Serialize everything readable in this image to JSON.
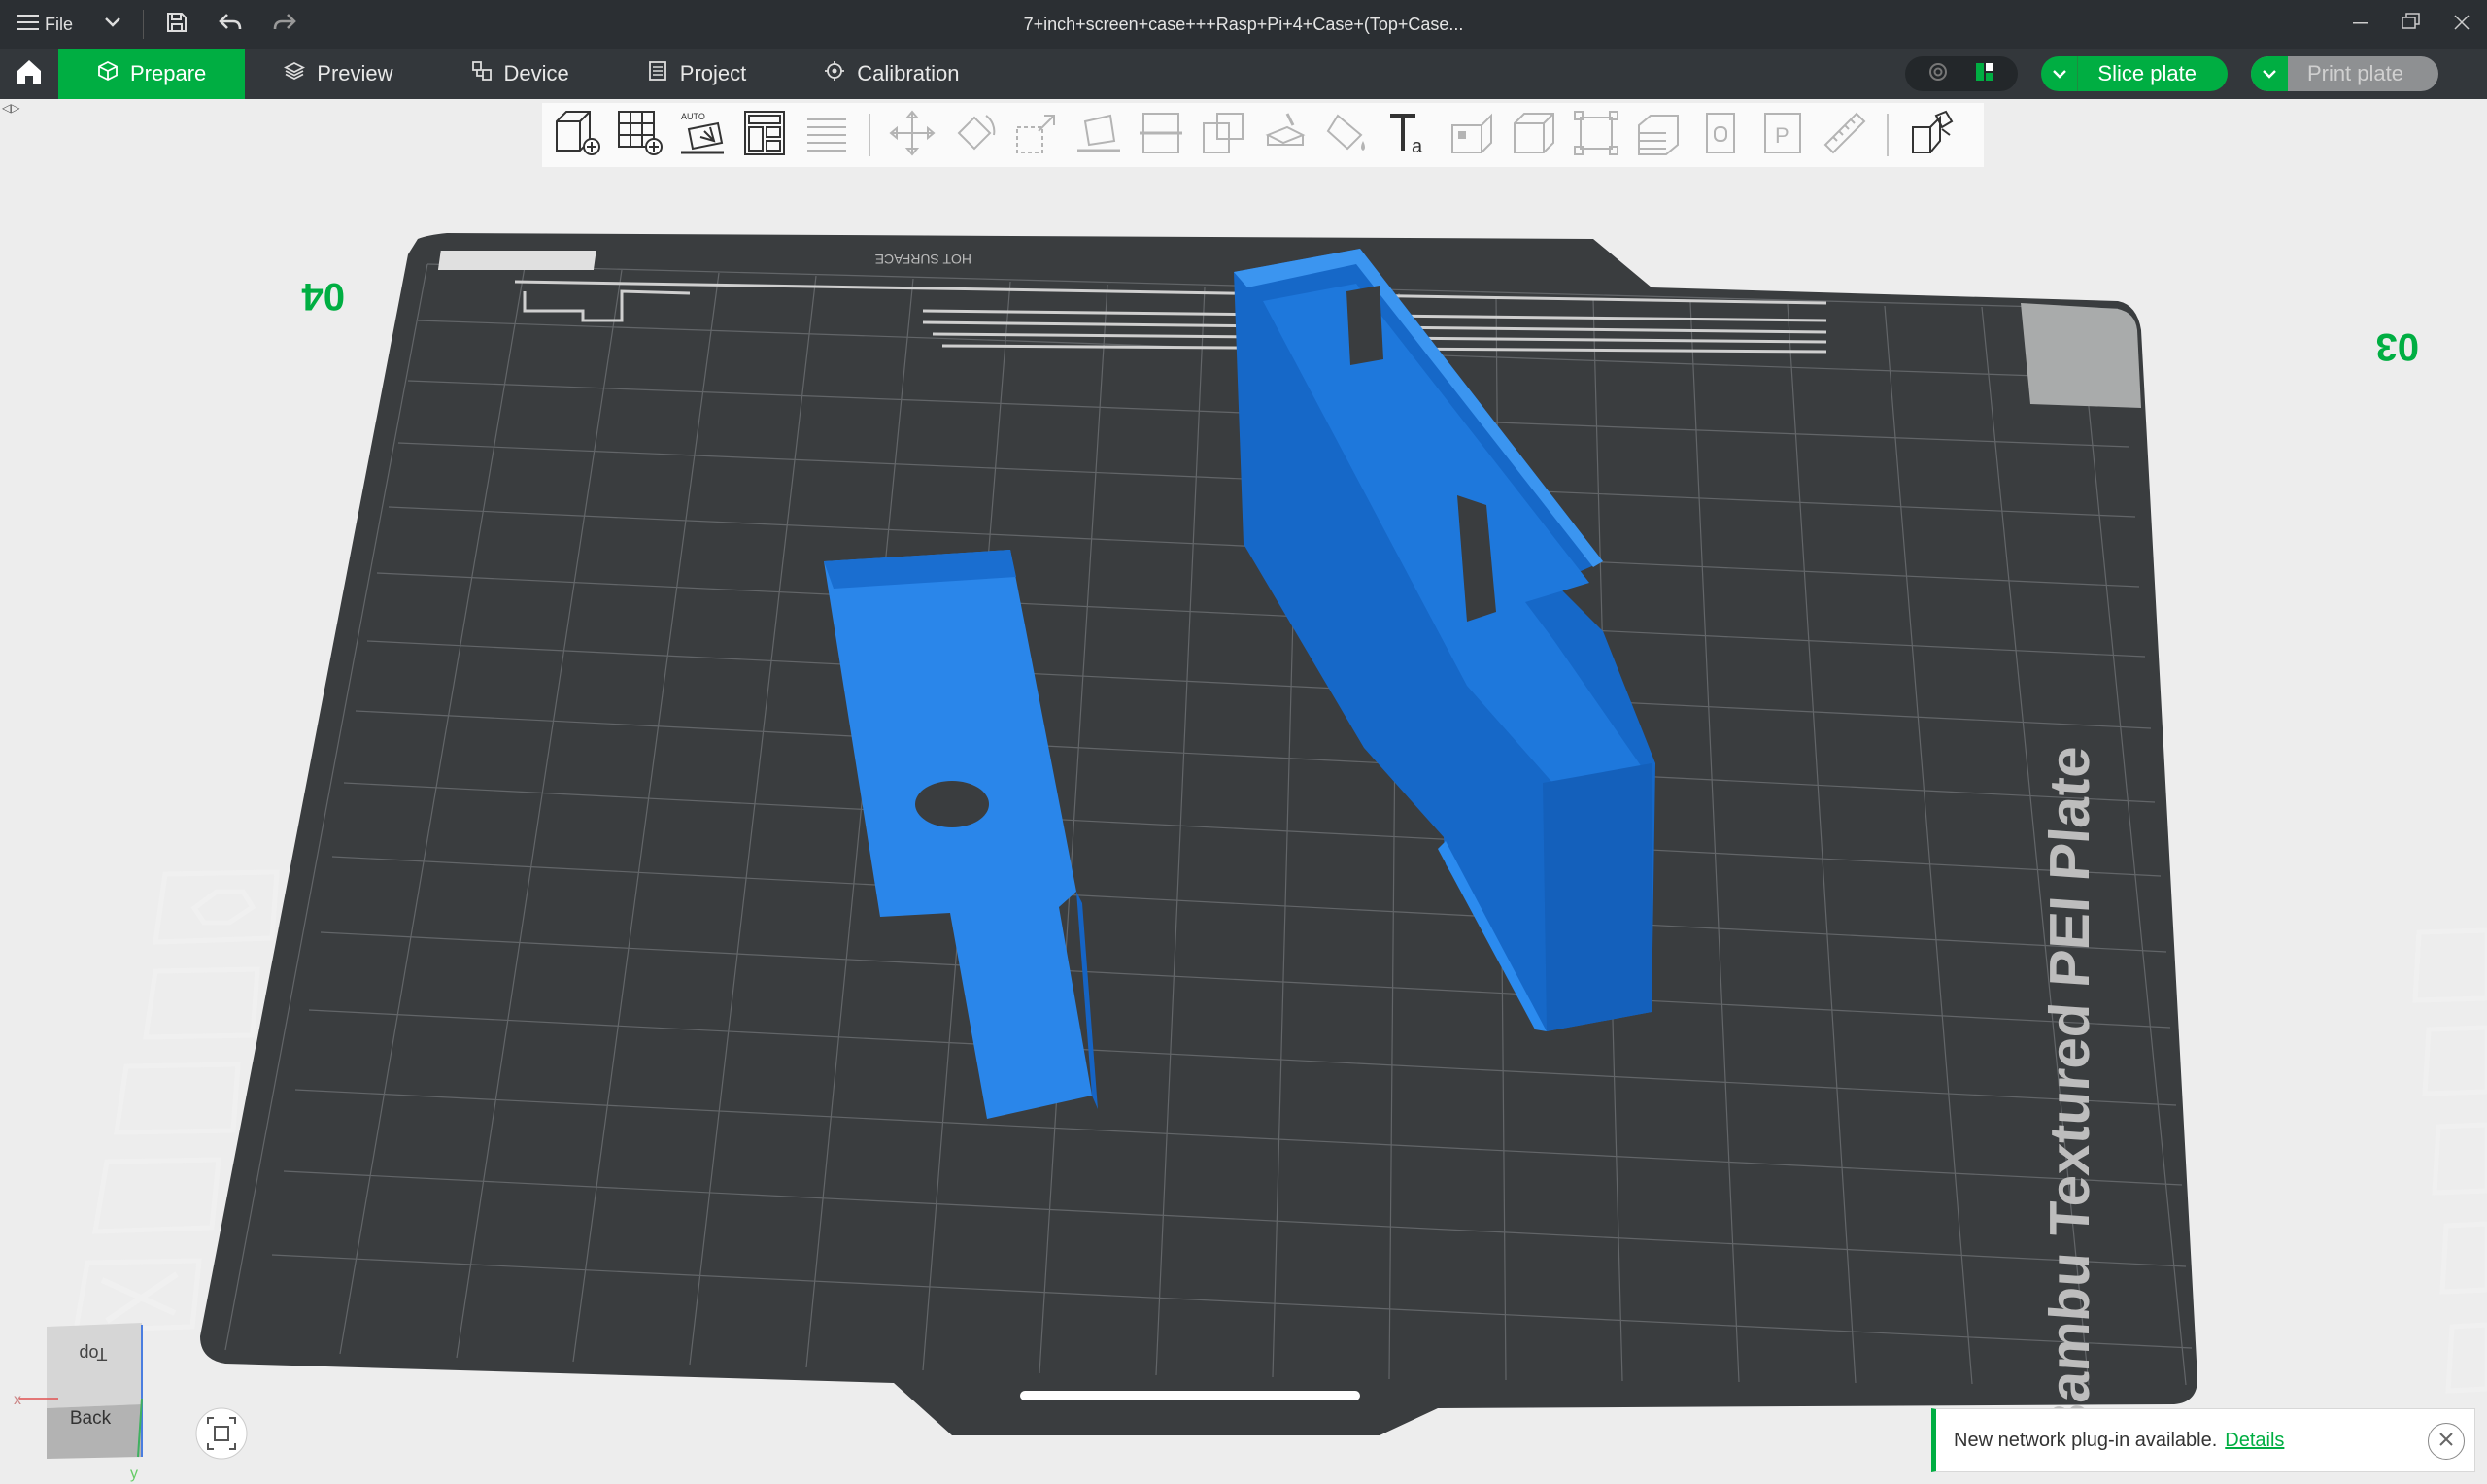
{
  "window": {
    "title": "7+inch+screen+case+++Rasp+Pi+4+Case+(Top+Case..."
  },
  "menu": {
    "file_label": "File"
  },
  "tabs": [
    {
      "label": "Prepare",
      "icon": "cube-icon",
      "active": true
    },
    {
      "label": "Preview",
      "icon": "layers-icon",
      "active": false
    },
    {
      "label": "Device",
      "icon": "device-icon",
      "active": false
    },
    {
      "label": "Project",
      "icon": "project-icon",
      "active": false
    },
    {
      "label": "Calibration",
      "icon": "calibration-icon",
      "active": false
    }
  ],
  "actions": {
    "slice_label": "Slice plate",
    "print_label": "Print plate"
  },
  "toolbar": {
    "tools": [
      "add-object-icon",
      "add-plate-icon",
      "auto-orient-icon",
      "arrange-icon",
      "layers-list-icon",
      "move-icon",
      "rotate-icon",
      "scale-icon",
      "lay-on-face-icon",
      "cut-icon",
      "boolean-icon",
      "support-paint-icon",
      "seam-paint-icon",
      "text-icon",
      "mesh-icon",
      "measure-box-icon",
      "bounding-icon",
      "variable-layer-icon",
      "assembly-icon",
      "place-icon",
      "ruler-icon",
      "explode-icon"
    ]
  },
  "plate": {
    "label": "Bambu Textured PEI Plate",
    "corner_left": "04",
    "corner_right": "03",
    "hot_surface": "HOT SURFACE"
  },
  "view_cube": {
    "top_label": "Top",
    "front_label": "Back",
    "axis_x": "x",
    "axis_y": "y"
  },
  "notification": {
    "text": "New network plug-in available.",
    "link": "Details"
  },
  "colors": {
    "accent": "#00ae42",
    "model": "#1f7fe0",
    "plate": "#3a3d3f"
  }
}
